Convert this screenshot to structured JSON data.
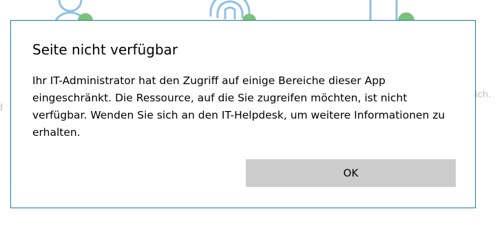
{
  "background": {
    "icons": [
      "person-icon",
      "fingerprint-icon",
      "device-icon"
    ],
    "accent_color": "#7bc27a",
    "icon_outline_color": "#8fc1e6",
    "left_text": "d",
    "right_text": "ich."
  },
  "dialog": {
    "title": "Seite nicht verfügbar",
    "message": "Ihr IT-Administrator hat den Zugriff auf einige Bereiche dieser App eingeschränkt. Die Ressource, auf die Sie zugreifen möchten, ist nicht verfügbar. Wenden Sie sich an den IT-Helpdesk, um weitere Informationen zu erhalten.",
    "ok_label": "OK",
    "border_color": "#1a74ba",
    "button_color": "#cccccc"
  }
}
